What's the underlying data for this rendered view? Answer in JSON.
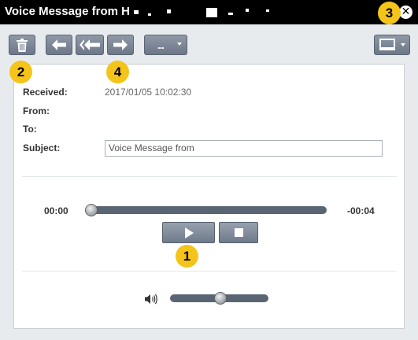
{
  "window": {
    "title": "Voice Message from H"
  },
  "toolbar": {
    "delete_icon": "trash-icon",
    "reply_icon": "reply-icon",
    "reply_all_icon": "reply-all-icon",
    "forward_icon": "forward-icon",
    "more_label": "...",
    "display_icon": "monitor-icon"
  },
  "callouts": [
    "1",
    "2",
    "3",
    "4"
  ],
  "message": {
    "received_label": "Received:",
    "received_value": "2017/01/05 10:02:30",
    "from_label": "From:",
    "to_label": "To:",
    "subject_label": "Subject:",
    "subject_value": "Voice Message from"
  },
  "player": {
    "elapsed": "00:00",
    "remaining": "-00:04",
    "progress_fraction": 0.0,
    "volume_fraction": 0.5
  },
  "colors": {
    "titlebar": "#000000",
    "badge": "#f4c41b",
    "button": "#7c8697"
  }
}
